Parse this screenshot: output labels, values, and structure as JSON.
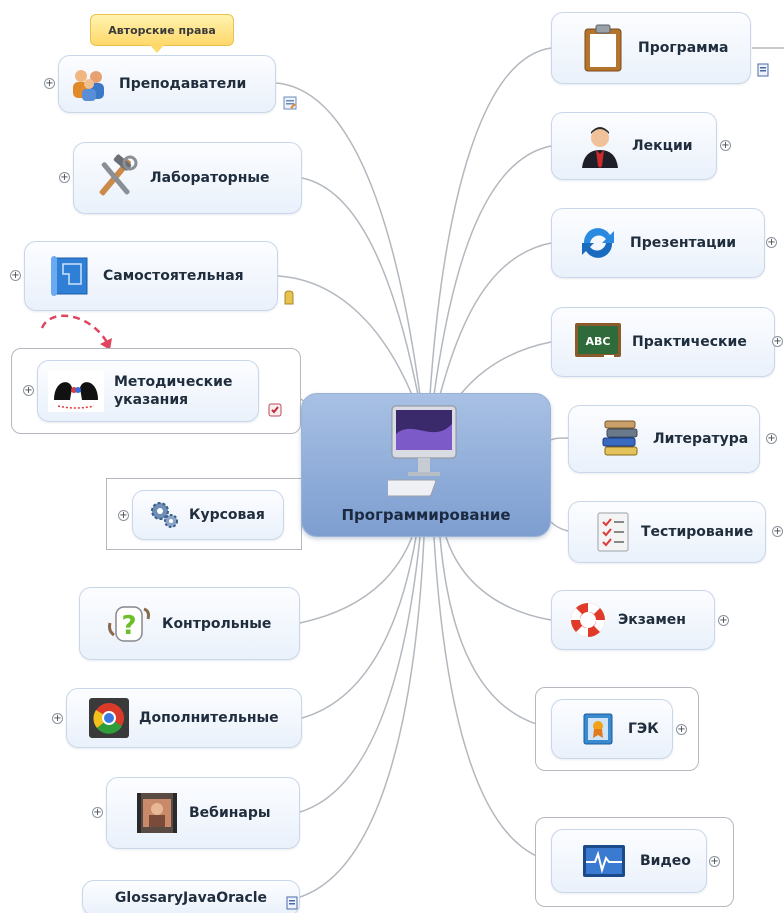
{
  "central": {
    "label": "Программирование",
    "icon": "imac-icon"
  },
  "callout": {
    "label": "Авторские права"
  },
  "left": [
    {
      "key": "teachers",
      "label": "Преподаватели",
      "icon": "people-icon"
    },
    {
      "key": "labs",
      "label": "Лабораторные",
      "icon": "tools-icon"
    },
    {
      "key": "selfwork",
      "label": "Самостоятельная",
      "icon": "blueprint-icon"
    },
    {
      "key": "guidelines",
      "label_line1": "Методические",
      "label_line2": "указания",
      "icon": "heads-icon"
    },
    {
      "key": "course",
      "label": "Курсовая",
      "icon": "gears-icon"
    },
    {
      "key": "control",
      "label": "Контрольные",
      "icon": "question-icon"
    },
    {
      "key": "extra",
      "label": "Дополнительные",
      "icon": "chrome-icon"
    },
    {
      "key": "webinars",
      "label": "Вебинары",
      "icon": "film-icon"
    },
    {
      "key": "glossary",
      "label": "GlossaryJavaOracle"
    }
  ],
  "right": [
    {
      "key": "program",
      "label": "Программа",
      "icon": "clipboard-icon"
    },
    {
      "key": "lectures",
      "label": "Лекции",
      "icon": "lecturer-icon"
    },
    {
      "key": "presentations",
      "label": "Презентации",
      "icon": "refresh-icon"
    },
    {
      "key": "practice",
      "label": "Практические",
      "icon": "chalkboard-icon"
    },
    {
      "key": "literature",
      "label": "Литература",
      "icon": "books-icon"
    },
    {
      "key": "testing",
      "label": "Тестирование",
      "icon": "checklist-icon"
    },
    {
      "key": "exam",
      "label": "Экзамен",
      "icon": "lifebuoy-icon"
    },
    {
      "key": "gek",
      "label": "ГЭК",
      "icon": "certificate-icon"
    },
    {
      "key": "video",
      "label": "Видео",
      "icon": "monitor-wave-icon"
    }
  ],
  "colors": {
    "link": "#b3b8bf",
    "node_border": "#c9d7ea",
    "central_top": "#a8c0e4",
    "central_bottom": "#7d9ed0",
    "dashed_arrow": "#e0455f"
  }
}
